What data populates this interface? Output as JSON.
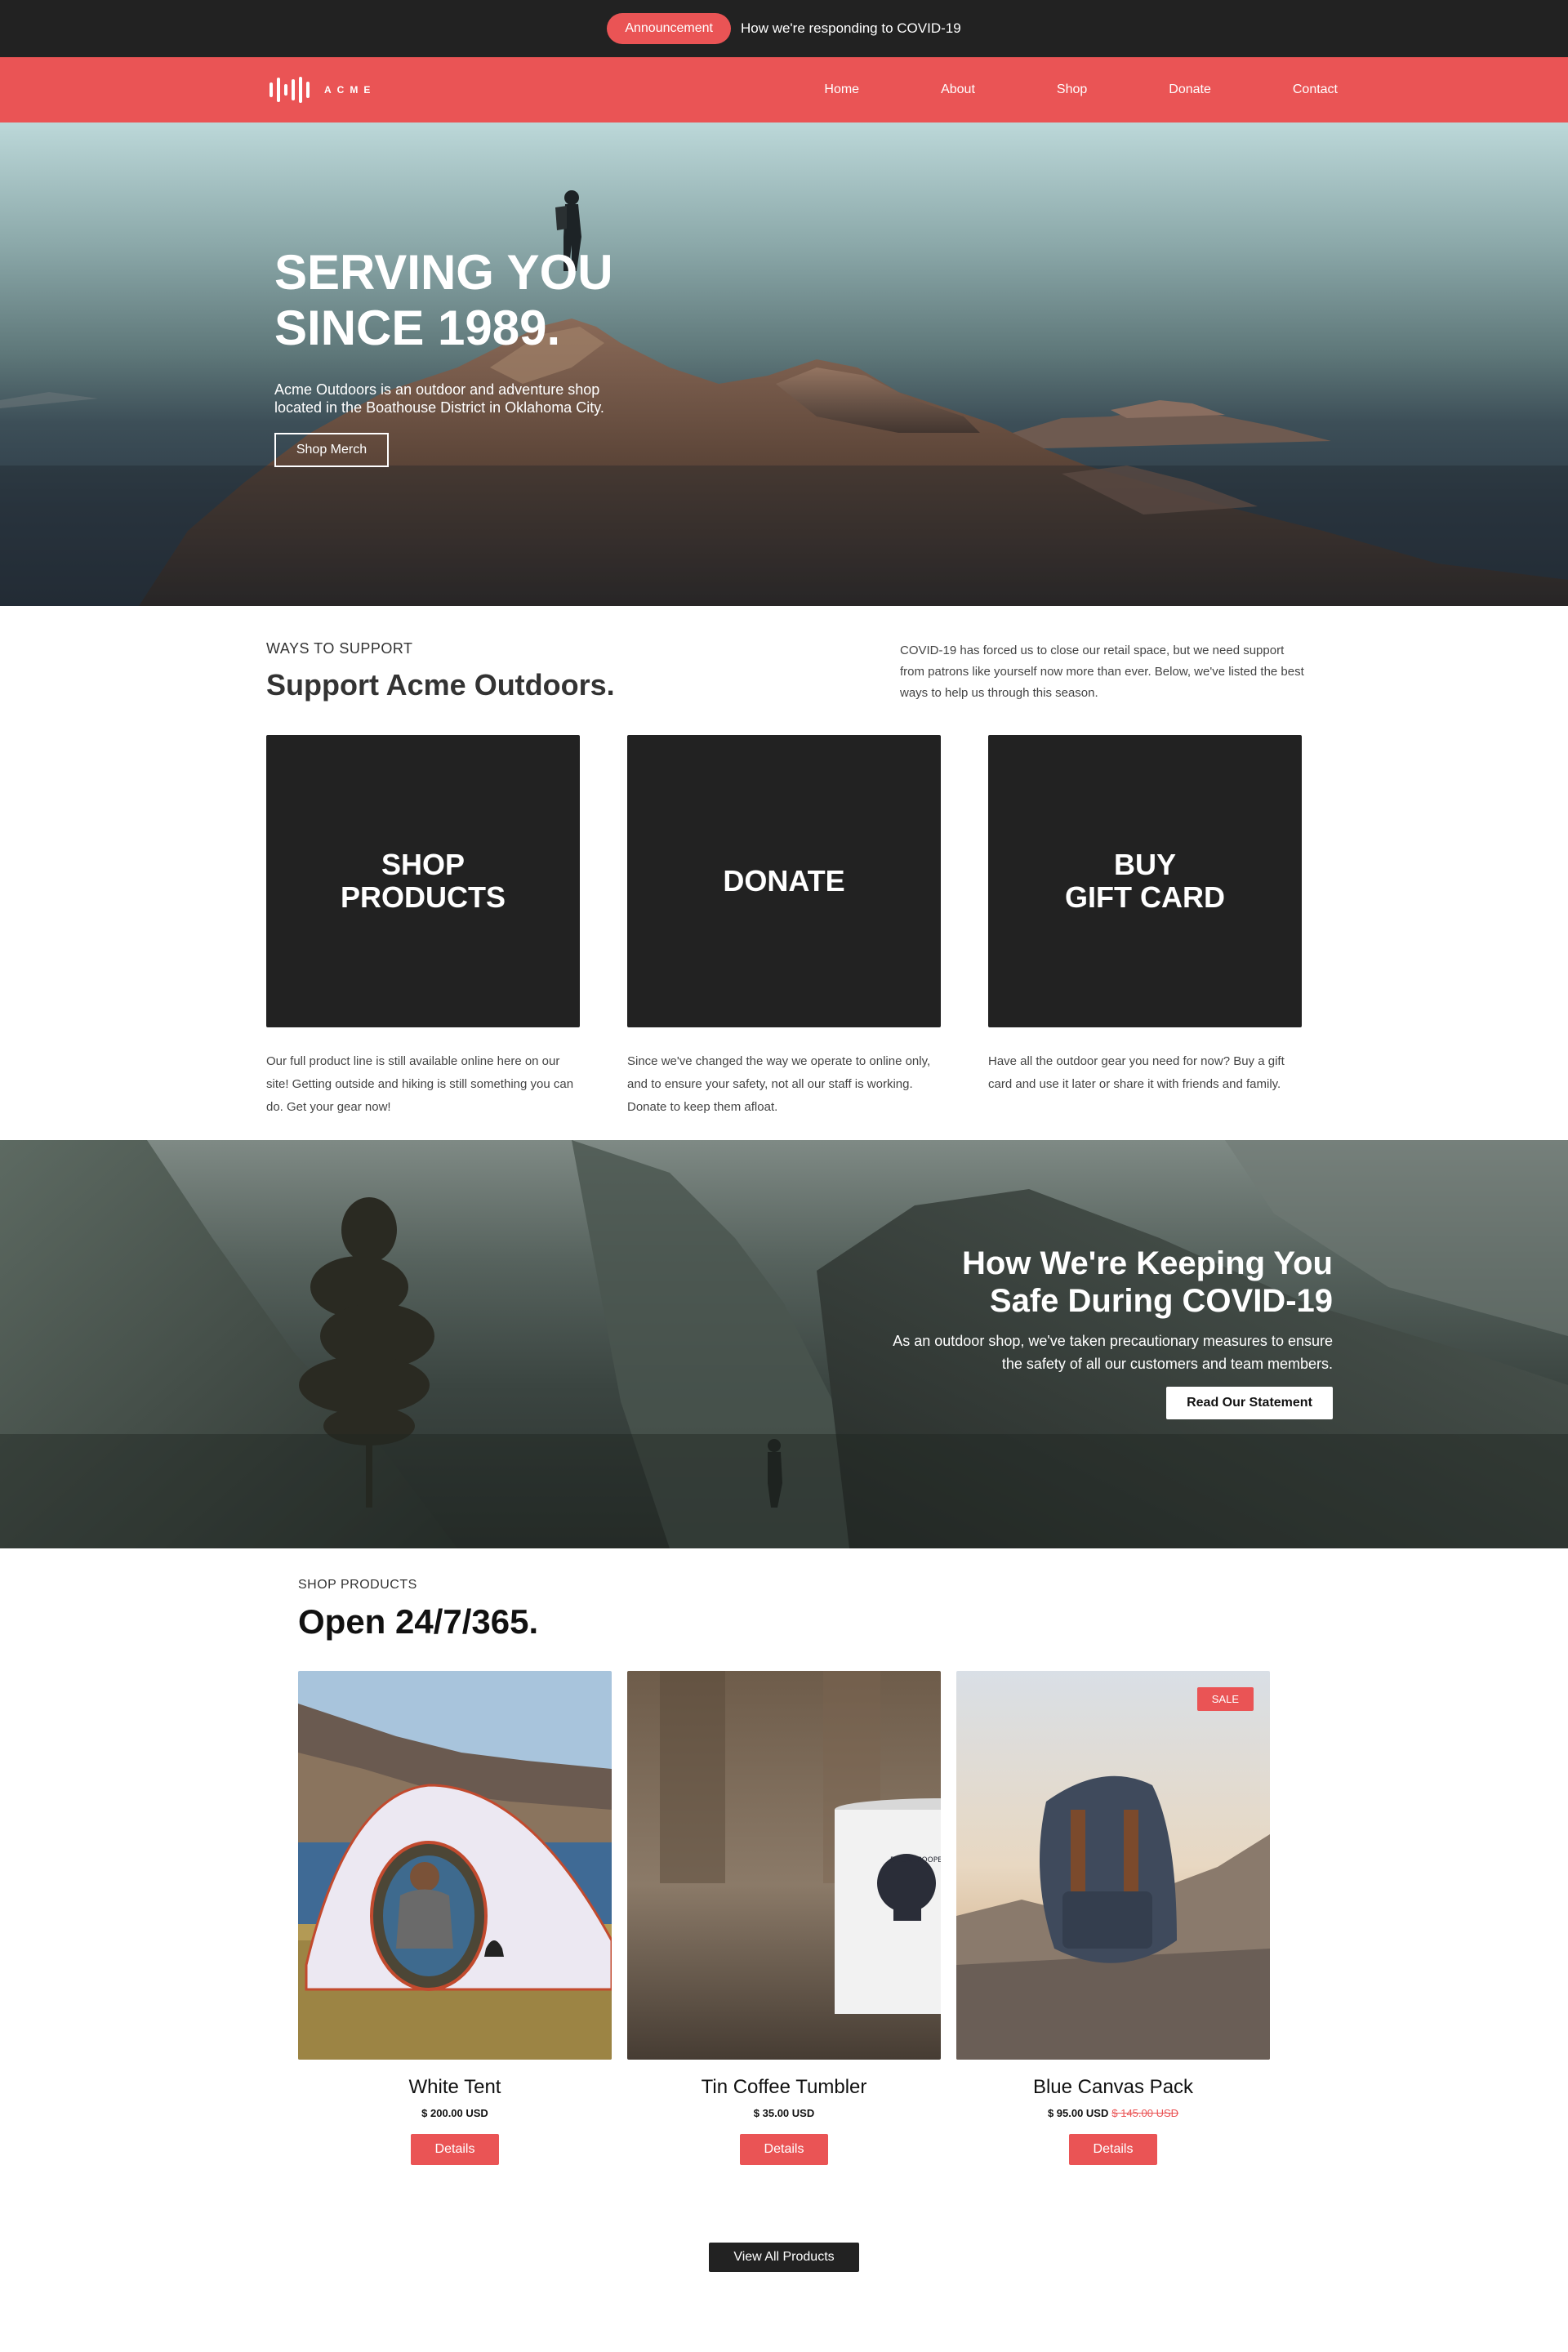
{
  "announcement": {
    "badge": "Announcement",
    "message": "How we're responding to COVID-19"
  },
  "nav": {
    "logo_text": "ACME",
    "items": [
      "Home",
      "About",
      "Shop",
      "Donate",
      "Contact"
    ]
  },
  "hero": {
    "title_line1": "SERVING YOU",
    "title_line2": "SINCE 1989.",
    "description": "Acme Outdoors is an outdoor and adventure shop located in the Boathouse District in Oklahoma City.",
    "button": "Shop Merch"
  },
  "support": {
    "eyebrow": "WAYS TO SUPPORT",
    "title": "Support Acme Outdoors.",
    "intro": "COVID-19 has forced us to close our retail space, but we need support from patrons like yourself now more than ever. Below, we've listed the best ways to help us through this season.",
    "cards": [
      {
        "label": "SHOP\nPRODUCTS",
        "description": "Our full product line is still available online here on our site! Getting outside and hiking is still something you can do. Get your gear now!"
      },
      {
        "label": "DONATE",
        "description": "Since we've changed the way we operate to online only, and to ensure your safety, not all our staff is working. Donate to keep them afloat."
      },
      {
        "label": "BUY\nGIFT CARD",
        "description": "Have all the outdoor gear you need for now? Buy a gift card and use it later or share it with friends and family."
      }
    ]
  },
  "covid": {
    "title_line1": "How We're Keeping You",
    "title_line2": "Safe During COVID-19",
    "description": "As an outdoor shop, we've taken precautionary measures to ensure the safety of all our customers and team members.",
    "button": "Read Our Statement"
  },
  "shop": {
    "eyebrow": "SHOP PRODUCTS",
    "title": "Open 24/7/365.",
    "products": [
      {
        "name": "White Tent",
        "price": "$ 200.00 USD",
        "old_price": "",
        "button": "Details"
      },
      {
        "name": "Tin Coffee Tumbler",
        "price": "$ 35.00 USD",
        "old_price": "",
        "button": "Details"
      },
      {
        "name": "Blue Canvas Pack",
        "price": "$ 95.00 USD",
        "old_price": "$ 145.00 USD",
        "button": "Details",
        "badge": "SALE"
      }
    ],
    "view_all": "View All Products",
    "mug_print": "DECAF POOPER"
  },
  "colors": {
    "accent": "#ea5455",
    "dark": "#222222",
    "white": "#ffffff"
  }
}
